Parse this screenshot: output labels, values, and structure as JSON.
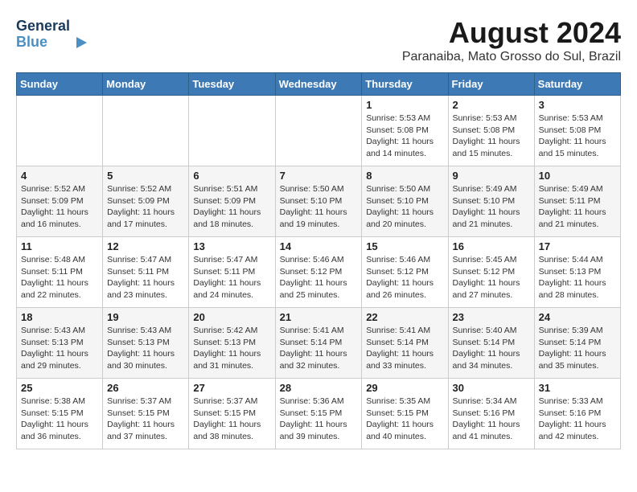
{
  "header": {
    "logo_general": "General",
    "logo_blue": "Blue",
    "title": "August 2024",
    "subtitle": "Paranaiba, Mato Grosso do Sul, Brazil"
  },
  "weekdays": [
    "Sunday",
    "Monday",
    "Tuesday",
    "Wednesday",
    "Thursday",
    "Friday",
    "Saturday"
  ],
  "weeks": [
    {
      "days": [
        {
          "number": "",
          "info": ""
        },
        {
          "number": "",
          "info": ""
        },
        {
          "number": "",
          "info": ""
        },
        {
          "number": "",
          "info": ""
        },
        {
          "number": "1",
          "sunrise": "5:53 AM",
          "sunset": "5:08 PM",
          "daylight": "11 hours and 14 minutes."
        },
        {
          "number": "2",
          "sunrise": "5:53 AM",
          "sunset": "5:08 PM",
          "daylight": "11 hours and 15 minutes."
        },
        {
          "number": "3",
          "sunrise": "5:53 AM",
          "sunset": "5:08 PM",
          "daylight": "11 hours and 15 minutes."
        }
      ]
    },
    {
      "days": [
        {
          "number": "4",
          "sunrise": "5:52 AM",
          "sunset": "5:09 PM",
          "daylight": "11 hours and 16 minutes."
        },
        {
          "number": "5",
          "sunrise": "5:52 AM",
          "sunset": "5:09 PM",
          "daylight": "11 hours and 17 minutes."
        },
        {
          "number": "6",
          "sunrise": "5:51 AM",
          "sunset": "5:09 PM",
          "daylight": "11 hours and 18 minutes."
        },
        {
          "number": "7",
          "sunrise": "5:50 AM",
          "sunset": "5:10 PM",
          "daylight": "11 hours and 19 minutes."
        },
        {
          "number": "8",
          "sunrise": "5:50 AM",
          "sunset": "5:10 PM",
          "daylight": "11 hours and 20 minutes."
        },
        {
          "number": "9",
          "sunrise": "5:49 AM",
          "sunset": "5:10 PM",
          "daylight": "11 hours and 21 minutes."
        },
        {
          "number": "10",
          "sunrise": "5:49 AM",
          "sunset": "5:11 PM",
          "daylight": "11 hours and 21 minutes."
        }
      ]
    },
    {
      "days": [
        {
          "number": "11",
          "sunrise": "5:48 AM",
          "sunset": "5:11 PM",
          "daylight": "11 hours and 22 minutes."
        },
        {
          "number": "12",
          "sunrise": "5:47 AM",
          "sunset": "5:11 PM",
          "daylight": "11 hours and 23 minutes."
        },
        {
          "number": "13",
          "sunrise": "5:47 AM",
          "sunset": "5:11 PM",
          "daylight": "11 hours and 24 minutes."
        },
        {
          "number": "14",
          "sunrise": "5:46 AM",
          "sunset": "5:12 PM",
          "daylight": "11 hours and 25 minutes."
        },
        {
          "number": "15",
          "sunrise": "5:46 AM",
          "sunset": "5:12 PM",
          "daylight": "11 hours and 26 minutes."
        },
        {
          "number": "16",
          "sunrise": "5:45 AM",
          "sunset": "5:12 PM",
          "daylight": "11 hours and 27 minutes."
        },
        {
          "number": "17",
          "sunrise": "5:44 AM",
          "sunset": "5:13 PM",
          "daylight": "11 hours and 28 minutes."
        }
      ]
    },
    {
      "days": [
        {
          "number": "18",
          "sunrise": "5:43 AM",
          "sunset": "5:13 PM",
          "daylight": "11 hours and 29 minutes."
        },
        {
          "number": "19",
          "sunrise": "5:43 AM",
          "sunset": "5:13 PM",
          "daylight": "11 hours and 30 minutes."
        },
        {
          "number": "20",
          "sunrise": "5:42 AM",
          "sunset": "5:13 PM",
          "daylight": "11 hours and 31 minutes."
        },
        {
          "number": "21",
          "sunrise": "5:41 AM",
          "sunset": "5:14 PM",
          "daylight": "11 hours and 32 minutes."
        },
        {
          "number": "22",
          "sunrise": "5:41 AM",
          "sunset": "5:14 PM",
          "daylight": "11 hours and 33 minutes."
        },
        {
          "number": "23",
          "sunrise": "5:40 AM",
          "sunset": "5:14 PM",
          "daylight": "11 hours and 34 minutes."
        },
        {
          "number": "24",
          "sunrise": "5:39 AM",
          "sunset": "5:14 PM",
          "daylight": "11 hours and 35 minutes."
        }
      ]
    },
    {
      "days": [
        {
          "number": "25",
          "sunrise": "5:38 AM",
          "sunset": "5:15 PM",
          "daylight": "11 hours and 36 minutes."
        },
        {
          "number": "26",
          "sunrise": "5:37 AM",
          "sunset": "5:15 PM",
          "daylight": "11 hours and 37 minutes."
        },
        {
          "number": "27",
          "sunrise": "5:37 AM",
          "sunset": "5:15 PM",
          "daylight": "11 hours and 38 minutes."
        },
        {
          "number": "28",
          "sunrise": "5:36 AM",
          "sunset": "5:15 PM",
          "daylight": "11 hours and 39 minutes."
        },
        {
          "number": "29",
          "sunrise": "5:35 AM",
          "sunset": "5:15 PM",
          "daylight": "11 hours and 40 minutes."
        },
        {
          "number": "30",
          "sunrise": "5:34 AM",
          "sunset": "5:16 PM",
          "daylight": "11 hours and 41 minutes."
        },
        {
          "number": "31",
          "sunrise": "5:33 AM",
          "sunset": "5:16 PM",
          "daylight": "11 hours and 42 minutes."
        }
      ]
    }
  ],
  "labels": {
    "sunrise": "Sunrise:",
    "sunset": "Sunset:",
    "daylight": "Daylight:"
  }
}
